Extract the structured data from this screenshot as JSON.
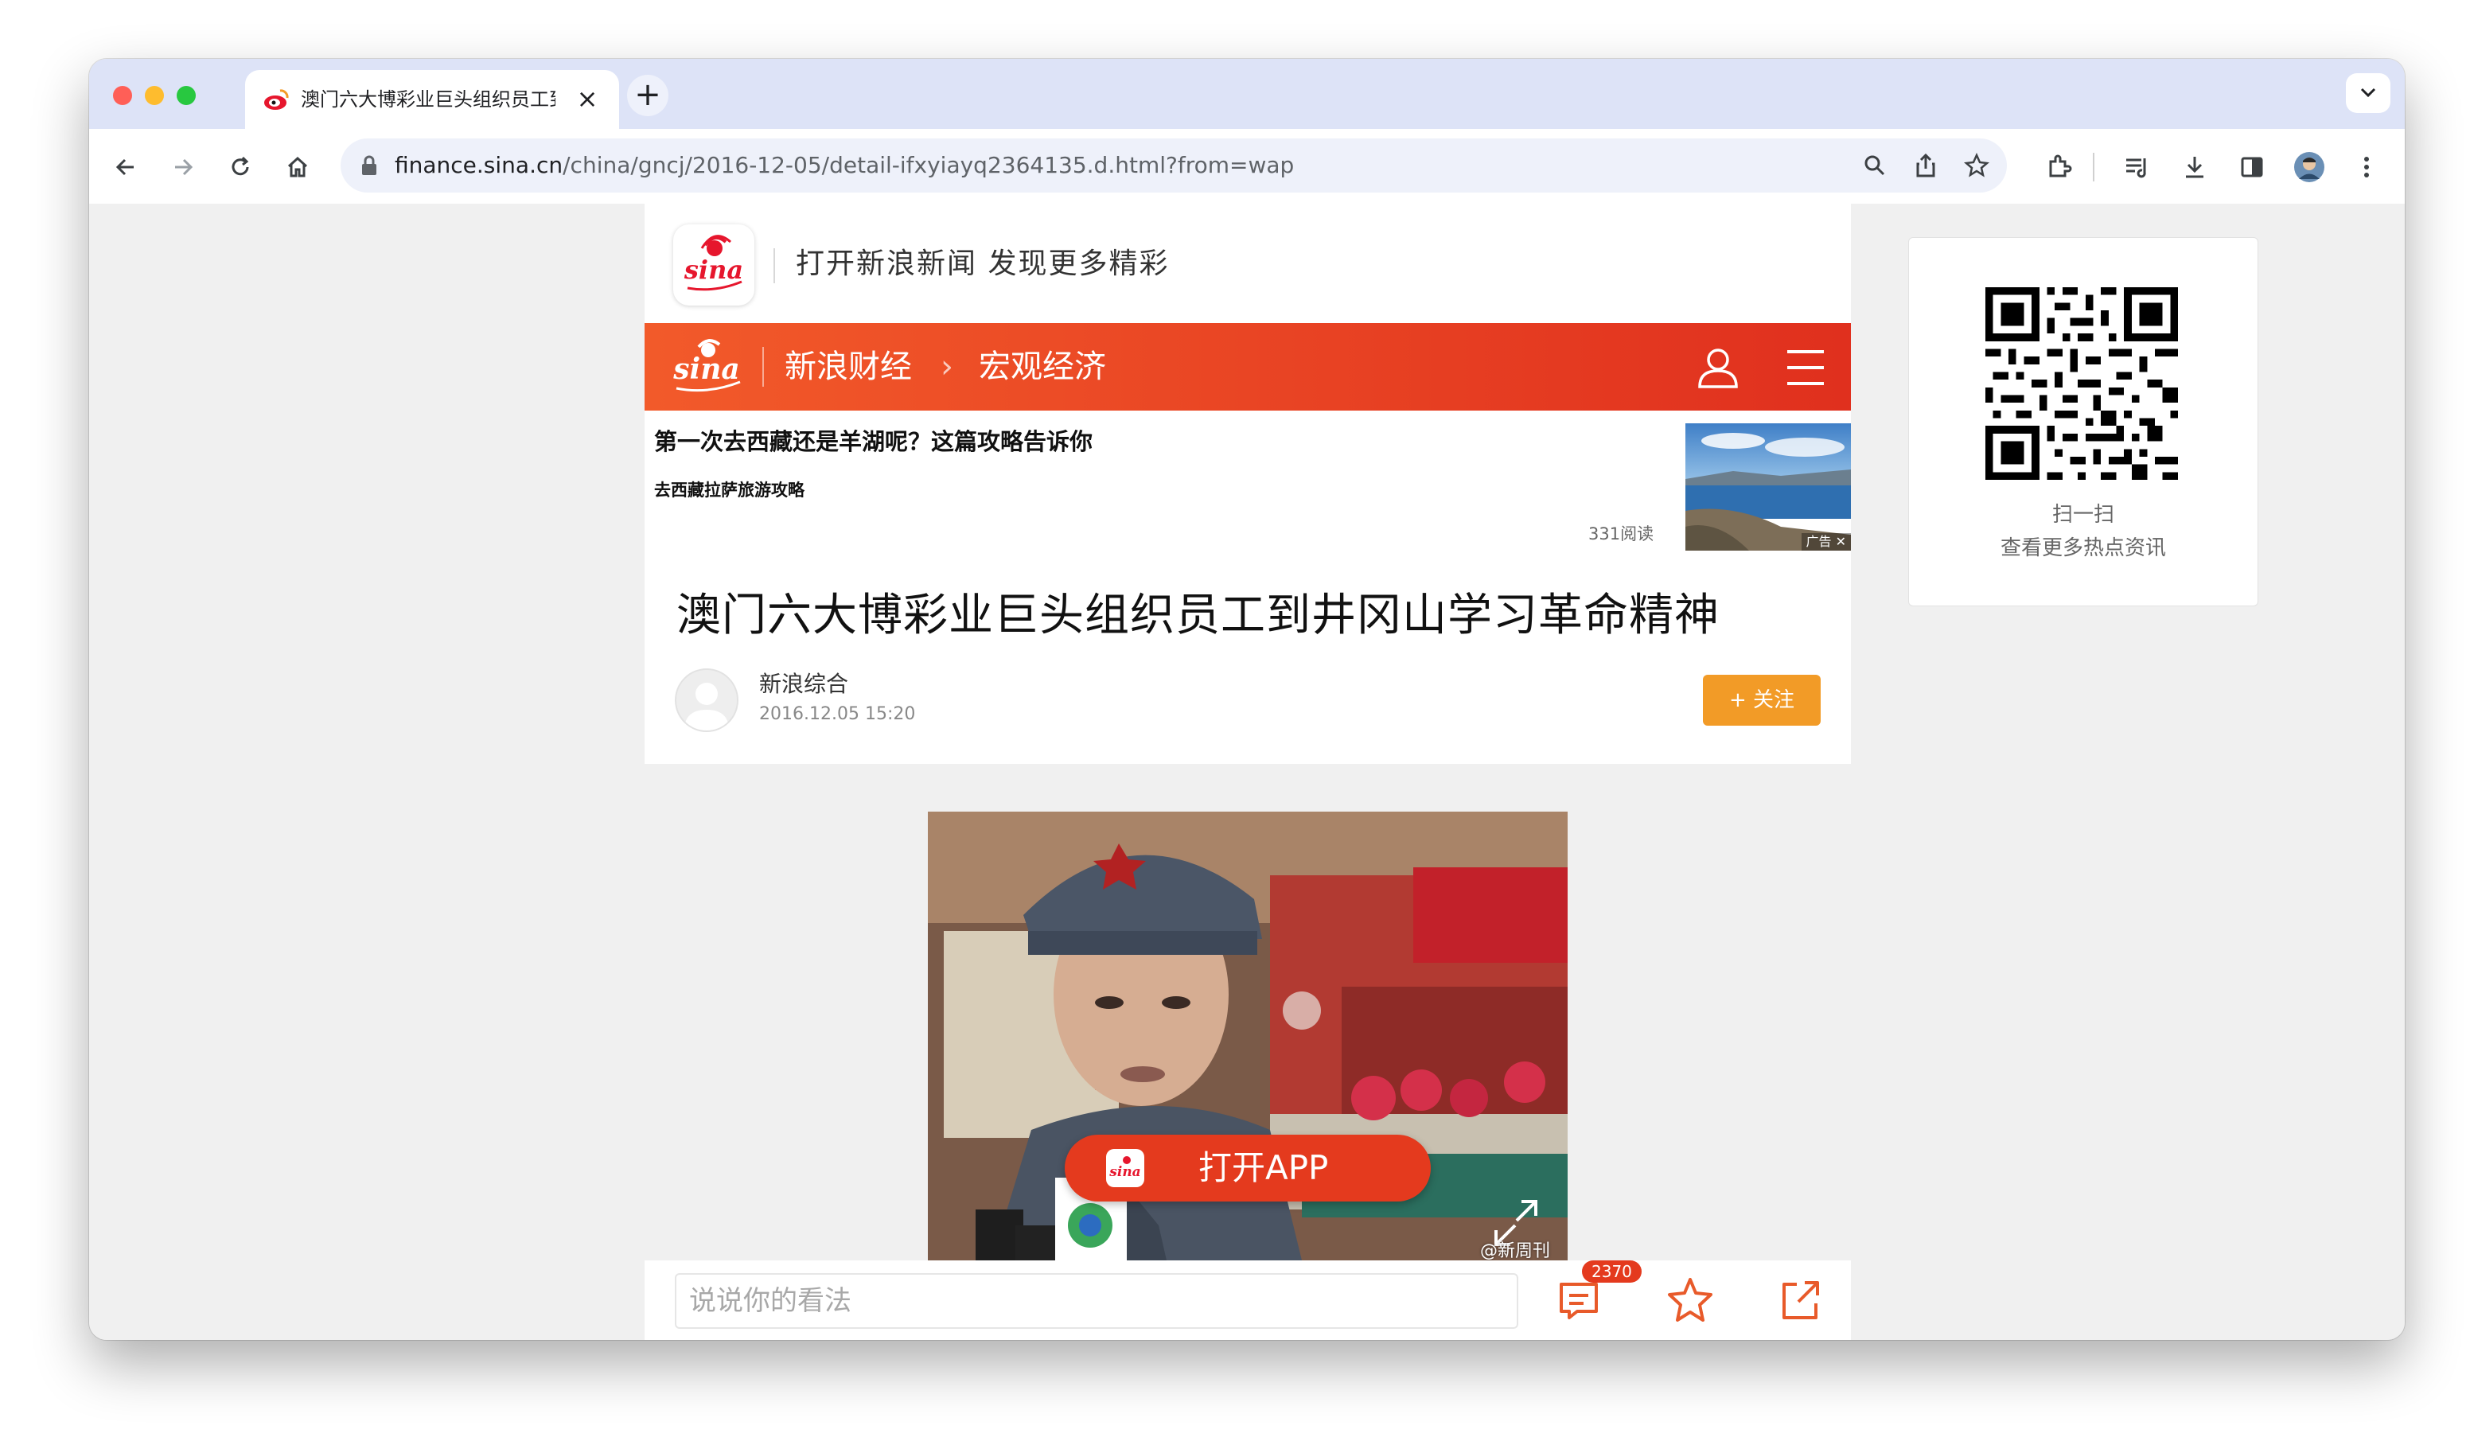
{
  "browser": {
    "tab_title": "澳门六大博彩业巨头组织员工到井冈山学习革命精神",
    "url_host": "finance.sina.cn",
    "url_path": "/china/gncj/2016-12-05/detail-ifxyiayq2364135.d.html?from=wap",
    "icons": [
      "back-icon",
      "forward-icon",
      "reload-icon",
      "home-icon",
      "lock-icon",
      "zoom-icon",
      "share-icon",
      "bookmark-star-icon",
      "extensions-icon",
      "reading-list-icon",
      "download-icon",
      "side-panel-icon",
      "profile-avatar",
      "more-menu-icon"
    ]
  },
  "banner": {
    "logo_text": "sina",
    "text": "打开新浪新闻 发现更多精彩"
  },
  "nav": {
    "logo_text": "sina",
    "section": "新浪财经",
    "chevron": "›",
    "subsection": "宏观经济"
  },
  "ad": {
    "title": "第一次去西藏还是羊湖呢？这篇攻略告诉你",
    "subtitle": "去西藏拉萨旅游攻略",
    "reads": "331阅读",
    "badge": "广告 ✕"
  },
  "article": {
    "title": "澳门六大博彩业巨头组织员工到井冈山学习革命精神",
    "author": "新浪综合",
    "date": "2016.12.05  15:20",
    "follow_label": "+ 关注",
    "photo_credit": "@新周刊"
  },
  "open_app": {
    "logo_text": "sina",
    "label": "打开APP"
  },
  "bottom": {
    "comment_placeholder": "说说你的看法",
    "comment_count": "2370"
  },
  "qr": {
    "line1": "扫一扫",
    "line2": "查看更多热点资讯"
  },
  "colors": {
    "sina_red": "#e43a1e",
    "follow_orange": "#f29b27",
    "tab_strip": "#dde3f7",
    "accent_icon": "#e85a2a"
  }
}
